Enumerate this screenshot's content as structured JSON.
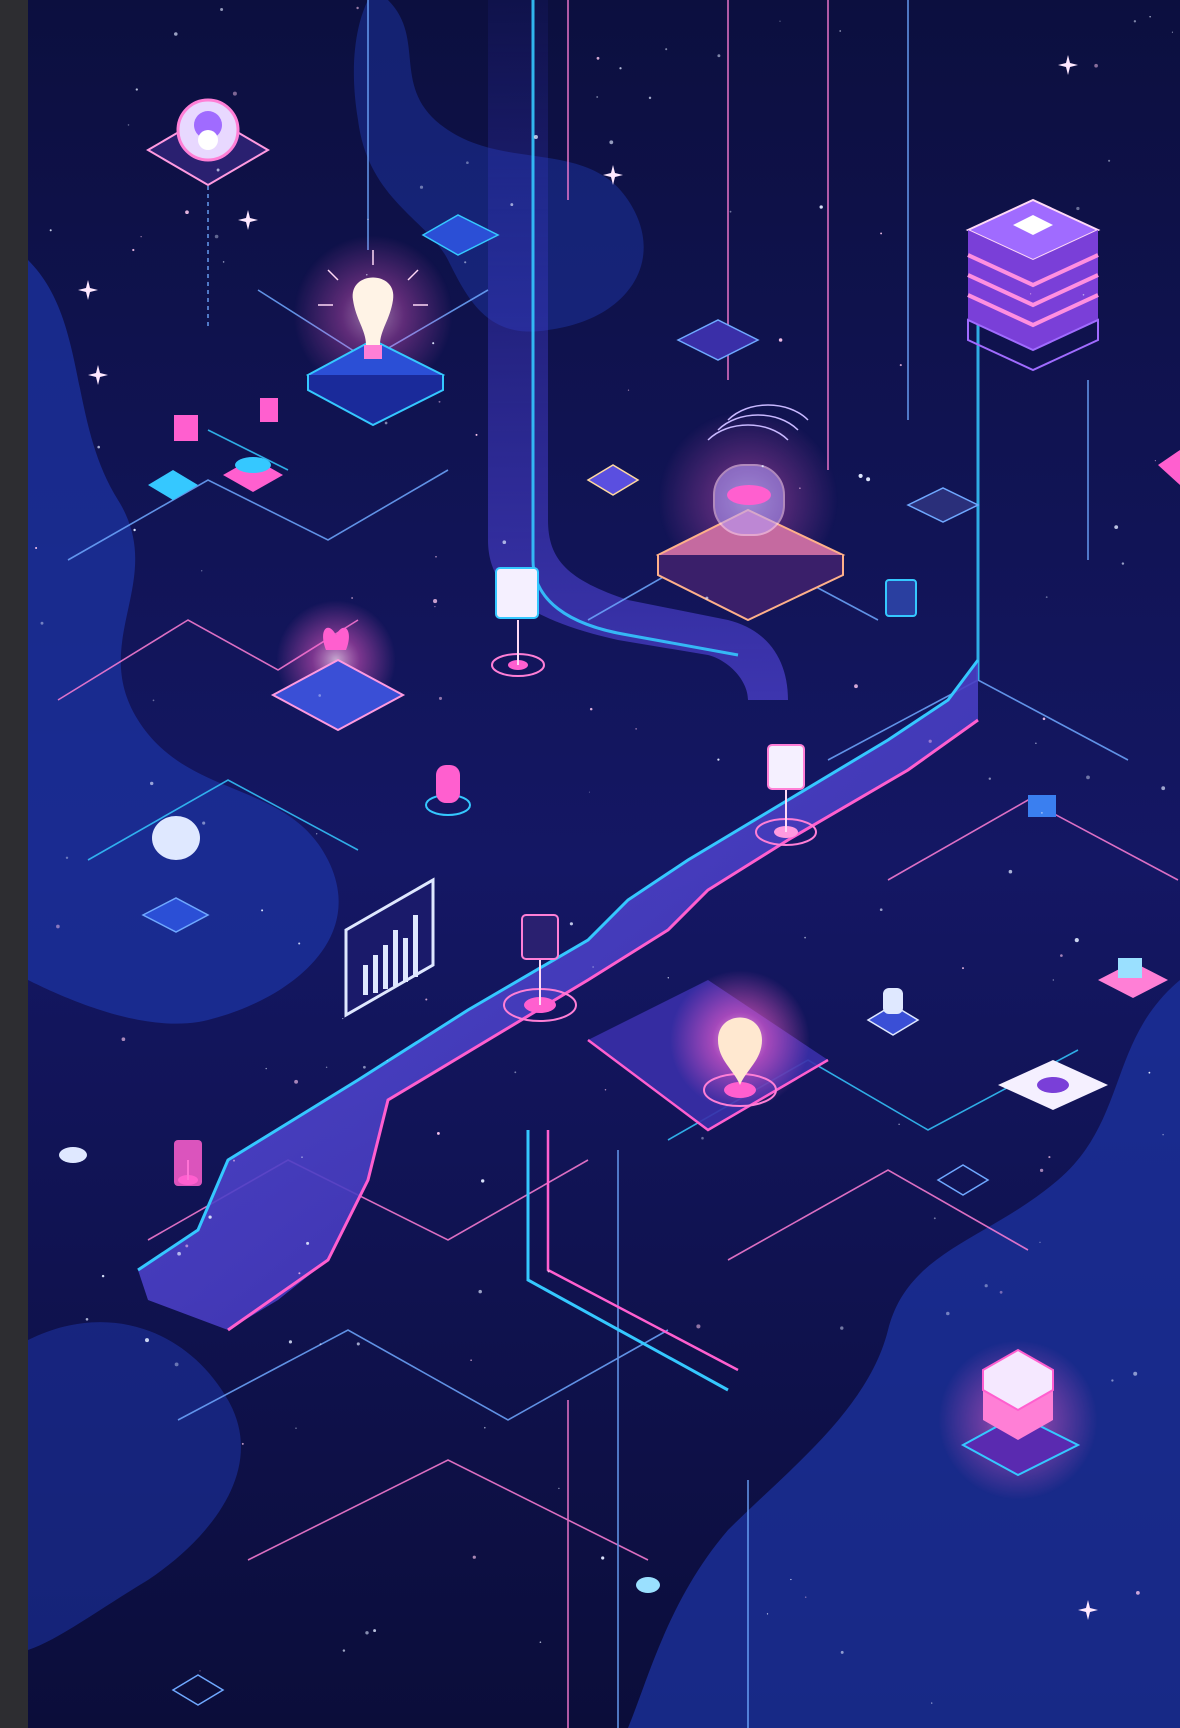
{
  "scene": {
    "kind": "illustration",
    "theme": "isometric neon circuit network in space",
    "colors": {
      "background": "#10145a",
      "deep": "#0b0d3a",
      "cloud": "#1f3aa8",
      "path": "#4b3fc8",
      "cyan": "#35c8ff",
      "pink": "#ff5fcf",
      "violet": "#a06bff",
      "glow": "#ffd9f6"
    },
    "icons": [
      "database-stack-icon",
      "lightbulb-icon",
      "bar-chart-icon",
      "map-pin-icon",
      "robot-avatar-icon",
      "beaker-icon",
      "cube-icon",
      "chip-icon"
    ]
  }
}
